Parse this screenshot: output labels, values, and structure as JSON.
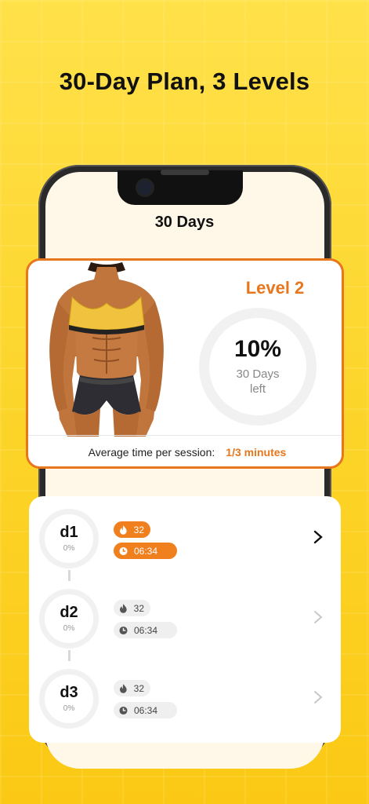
{
  "headline": "30-Day Plan, 3 Levels",
  "screen": {
    "title": "30 Days"
  },
  "level_card": {
    "level": "Level 2",
    "progress_percent": "10%",
    "progress_value": 0.1,
    "days_left_line1": "30 Days",
    "days_left_line2": "left",
    "avg_label": "Average time per session:",
    "avg_value": "1/3 minutes"
  },
  "days": [
    {
      "name": "d1",
      "percent": "0%",
      "calories": "32",
      "duration": "06:34",
      "active": true
    },
    {
      "name": "d2",
      "percent": "0%",
      "calories": "32",
      "duration": "06:34",
      "active": false
    },
    {
      "name": "d3",
      "percent": "0%",
      "calories": "32",
      "duration": "06:34",
      "active": false
    }
  ],
  "icons": [
    "flame-icon",
    "clock-icon",
    "chevron-right-icon"
  ],
  "colors": {
    "accent": "#e8761c",
    "background": "#fcd52a",
    "inactive_pill": "#efefef"
  }
}
